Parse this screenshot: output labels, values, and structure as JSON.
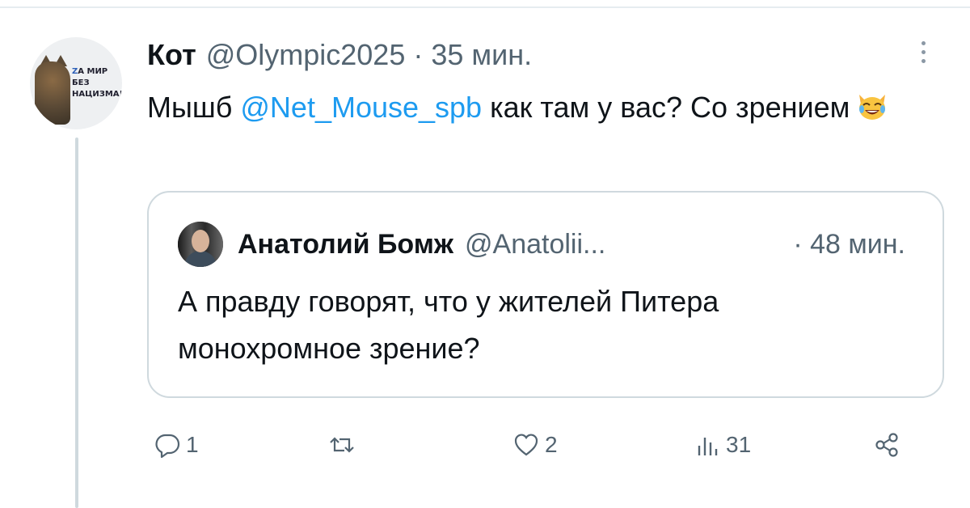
{
  "tweet": {
    "author_name": "Кот",
    "author_handle": "@Olympic2025",
    "separator": "·",
    "time": "35 мин.",
    "avatar_text_line1_z": "Z",
    "avatar_text_line1": "А МИР",
    "avatar_text_line2": "БЕЗ НАЦИЗМА!",
    "text_before": "Мышб ",
    "mention": "@Net_Mouse_spb",
    "text_after": " как там у вас? Со зрением",
    "emoji": "cat-tears-of-joy-icon"
  },
  "quote": {
    "author_name": "Анатолий Бомж",
    "author_handle": "@Anatolii...",
    "time": "· 48 мин.",
    "text": "А правду говорят, что у жителей Питера монохромное зрение?"
  },
  "actions": {
    "replies": "1",
    "retweets": "",
    "likes": "2",
    "views": "31"
  },
  "colors": {
    "mention": "#1d9bf0",
    "secondary_text": "#536471",
    "border": "#cfd9de"
  }
}
